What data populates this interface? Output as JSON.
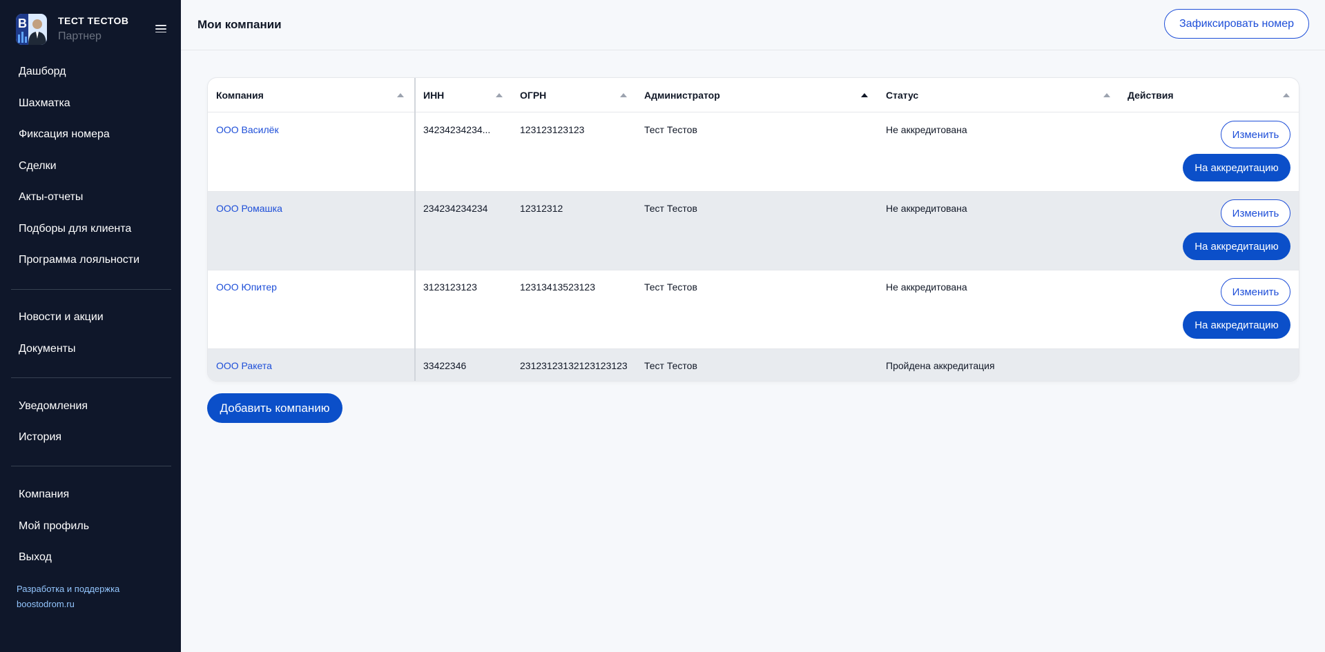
{
  "profile": {
    "name": "ТЕСТ ТЕСТОВ",
    "role": "Партнер"
  },
  "sidebar": {
    "group1": [
      "Дашборд",
      "Шахматка",
      "Фиксация номера",
      "Сделки",
      "Акты-отчеты",
      "Подборы для клиента",
      "Программа лояльности"
    ],
    "group2": [
      "Новости и акции",
      "Документы"
    ],
    "group3": [
      "Уведомления",
      "История"
    ],
    "group4": [
      "Компания",
      "Мой профиль",
      "Выход"
    ],
    "footer": [
      "Разработка и поддержка",
      "boostodrom.ru"
    ]
  },
  "header": {
    "title": "Мои компании",
    "fix_button": "Зафиксировать номер"
  },
  "table": {
    "columns": [
      "Компания",
      "ИНН",
      "ОГРН",
      "Администратор",
      "Статус",
      "Действия"
    ],
    "rows": [
      {
        "company": "ООО Василёк",
        "inn": "34234234234...",
        "ogrn": "123123123123",
        "admin": "Тест Тестов",
        "status": "Не аккредитована",
        "edit": "Изменить",
        "accredit": "На аккредитацию"
      },
      {
        "company": "ООО Ромашка",
        "inn": "234234234234",
        "ogrn": "12312312",
        "admin": "Тест Тестов",
        "status": "Не аккредитована",
        "edit": "Изменить",
        "accredit": "На аккредитацию"
      },
      {
        "company": "ООО Юпитер",
        "inn": "3123123123",
        "ogrn": "12313413523123",
        "admin": "Тест Тестов",
        "status": "Не аккредитована",
        "edit": "Изменить",
        "accredit": "На аккредитацию"
      },
      {
        "company": "ООО Ракета",
        "inn": "33422346",
        "ogrn": "23123123132123123123",
        "admin": "Тест Тестов",
        "status": "Пройдена аккредитация"
      }
    ]
  },
  "add_button": "Добавить компанию",
  "colors": {
    "sidebar_bg": "#0f172a",
    "accent": "#0b4fc9",
    "link": "#1d4ed8",
    "alt_row": "#e8ebef"
  }
}
